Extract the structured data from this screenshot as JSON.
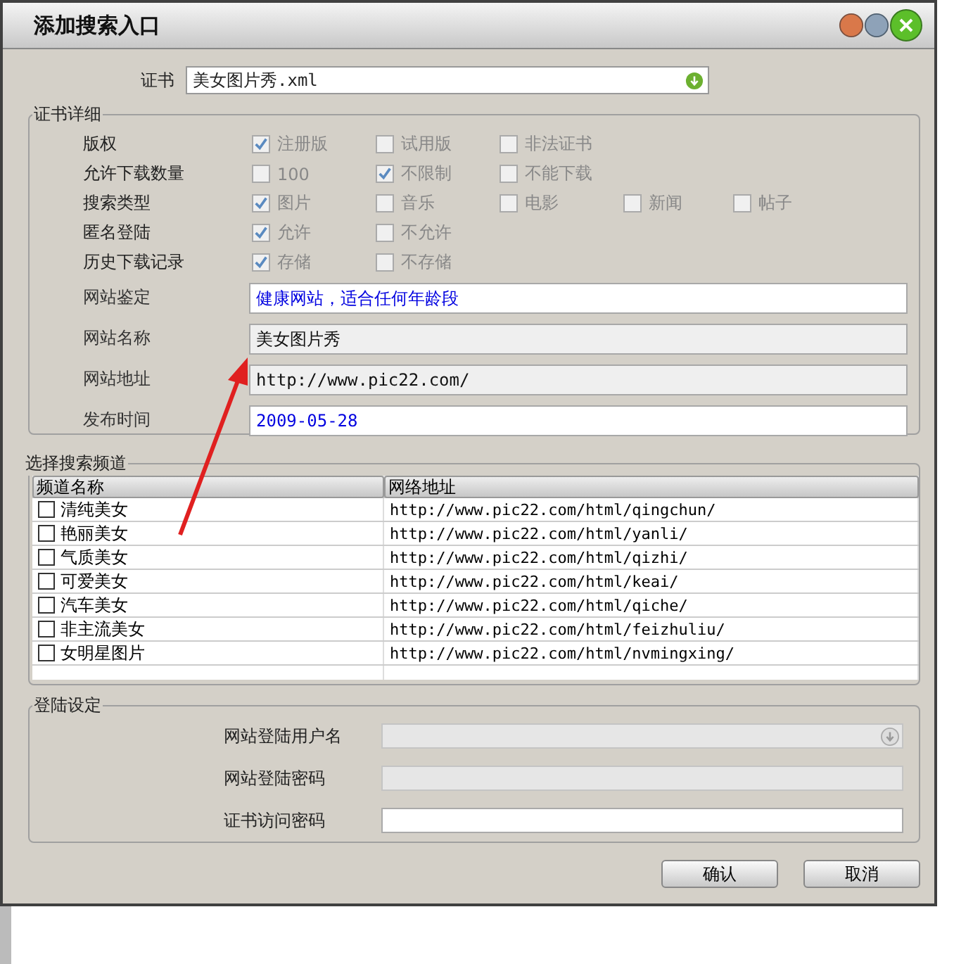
{
  "window": {
    "title": "添加搜索入口"
  },
  "certificate": {
    "label": "证书",
    "value": "美女图片秀.xml"
  },
  "details": {
    "title": "证书详细",
    "option_rows": [
      {
        "label": "版权",
        "options": [
          {
            "label": "注册版",
            "checked": true
          },
          {
            "label": "试用版",
            "checked": false
          },
          {
            "label": "非法证书",
            "checked": false
          }
        ]
      },
      {
        "label": "允许下载数量",
        "options": [
          {
            "label": "100",
            "checked": false
          },
          {
            "label": "不限制",
            "checked": true
          },
          {
            "label": "不能下载",
            "checked": false
          }
        ]
      },
      {
        "label": "搜索类型",
        "options": [
          {
            "label": "图片",
            "checked": true
          },
          {
            "label": "音乐",
            "checked": false
          },
          {
            "label": "电影",
            "checked": false
          },
          {
            "label": "新闻",
            "checked": false
          },
          {
            "label": "帖子",
            "checked": false
          }
        ]
      },
      {
        "label": "匿名登陆",
        "options": [
          {
            "label": "允许",
            "checked": true
          },
          {
            "label": "不允许",
            "checked": false
          }
        ]
      },
      {
        "label": "历史下载记录",
        "options": [
          {
            "label": "存储",
            "checked": true
          },
          {
            "label": "不存储",
            "checked": false
          }
        ]
      }
    ],
    "fields": [
      {
        "label": "网站鉴定",
        "value": "健康网站，适合任何年龄段",
        "disabled": false
      },
      {
        "label": "网站名称",
        "value": "美女图片秀",
        "disabled": true
      },
      {
        "label": "网站地址",
        "value": "http://www.pic22.com/",
        "disabled": true
      },
      {
        "label": "发布时间",
        "value": "2009-05-28",
        "disabled": false
      }
    ]
  },
  "channels": {
    "title": "选择搜索频道",
    "columns": [
      "频道名称",
      "网络地址"
    ],
    "rows": [
      {
        "name": "清纯美女",
        "url": "http://www.pic22.com/html/qingchun/",
        "checked": false
      },
      {
        "name": "艳丽美女",
        "url": "http://www.pic22.com/html/yanli/",
        "checked": false
      },
      {
        "name": "气质美女",
        "url": "http://www.pic22.com/html/qizhi/",
        "checked": false
      },
      {
        "name": "可爱美女",
        "url": "http://www.pic22.com/html/keai/",
        "checked": false
      },
      {
        "name": "汽车美女",
        "url": "http://www.pic22.com/html/qiche/",
        "checked": false
      },
      {
        "name": "非主流美女",
        "url": "http://www.pic22.com/html/feizhuliu/",
        "checked": false
      },
      {
        "name": "女明星图片",
        "url": "http://www.pic22.com/html/nvmingxing/",
        "checked": false
      }
    ]
  },
  "login": {
    "title": "登陆设定",
    "fields": [
      {
        "label": "网站登陆用户名",
        "kind": "dropdown",
        "disabled": true
      },
      {
        "label": "网站登陆密码",
        "kind": "text",
        "disabled": true
      },
      {
        "label": "证书访问密码",
        "kind": "text",
        "disabled": false
      }
    ]
  },
  "buttons": [
    "确认",
    "取消"
  ]
}
